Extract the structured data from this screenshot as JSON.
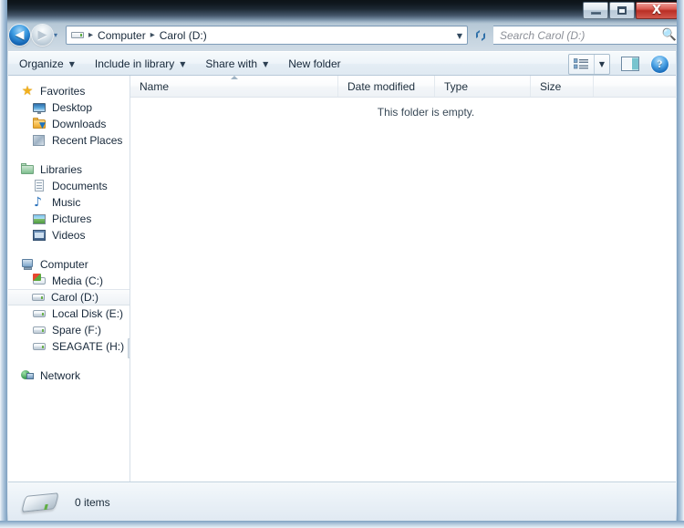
{
  "window": {
    "controls": {
      "minimize_label": "Minimize",
      "maximize_label": "Maximize",
      "close_label": "X"
    }
  },
  "navbar": {
    "back_label": "◀",
    "forward_label": "▶",
    "recent_pages_label": "▾",
    "address_icon": "drive-icon",
    "breadcrumbs": [
      "Computer",
      "Carol (D:)"
    ],
    "separator": "▸",
    "dropdown_label": "▼",
    "refresh_label": "refresh-icon",
    "search": {
      "placeholder": "Search Carol (D:)",
      "value": "",
      "icon": "search-icon"
    }
  },
  "toolbar": {
    "items": [
      {
        "label": "Organize",
        "has_caret": true
      },
      {
        "label": "Include in library",
        "has_caret": true
      },
      {
        "label": "Share with",
        "has_caret": true
      },
      {
        "label": "New folder",
        "has_caret": false
      }
    ],
    "caret": "▼",
    "views_icon": "view-list-icon",
    "views_caret": "▼",
    "preview_pane_icon": "preview-pane-icon",
    "help_label": "?"
  },
  "sidebar": {
    "groups": [
      {
        "header": {
          "label": "Favorites",
          "icon": "star-icon"
        },
        "items": [
          {
            "label": "Desktop",
            "icon": "desktop-icon"
          },
          {
            "label": "Downloads",
            "icon": "downloads-folder-icon"
          },
          {
            "label": "Recent Places",
            "icon": "recent-places-icon"
          }
        ]
      },
      {
        "header": {
          "label": "Libraries",
          "icon": "libraries-icon"
        },
        "items": [
          {
            "label": "Documents",
            "icon": "document-icon"
          },
          {
            "label": "Music",
            "icon": "music-note-icon"
          },
          {
            "label": "Pictures",
            "icon": "picture-icon"
          },
          {
            "label": "Videos",
            "icon": "video-icon"
          }
        ]
      },
      {
        "header": {
          "label": "Computer",
          "icon": "computer-icon"
        },
        "items": [
          {
            "label": "Media (C:)",
            "icon": "windows-drive-icon",
            "selected": false
          },
          {
            "label": "Carol (D:)",
            "icon": "drive-icon",
            "selected": true
          },
          {
            "label": "Local Disk (E:)",
            "icon": "drive-icon",
            "selected": false
          },
          {
            "label": "Spare (F:)",
            "icon": "drive-icon",
            "selected": false
          },
          {
            "label": "SEAGATE (H:)",
            "icon": "drive-icon",
            "selected": false
          }
        ]
      },
      {
        "header": {
          "label": "Network",
          "icon": "network-icon"
        },
        "items": []
      }
    ]
  },
  "filelist": {
    "columns": [
      {
        "label": "Name",
        "sorted": true
      },
      {
        "label": "Date modified",
        "sorted": false
      },
      {
        "label": "Type",
        "sorted": false
      },
      {
        "label": "Size",
        "sorted": false
      }
    ],
    "rows": [],
    "empty_message": "This folder is empty."
  },
  "statusbar": {
    "icon": "drive-icon",
    "item_count": "0 items",
    "detail": ""
  },
  "colors": {
    "accent_blue": "#1769b8",
    "close_red": "#b92f25",
    "selection": "#eef2f6",
    "text": "#17283a"
  }
}
